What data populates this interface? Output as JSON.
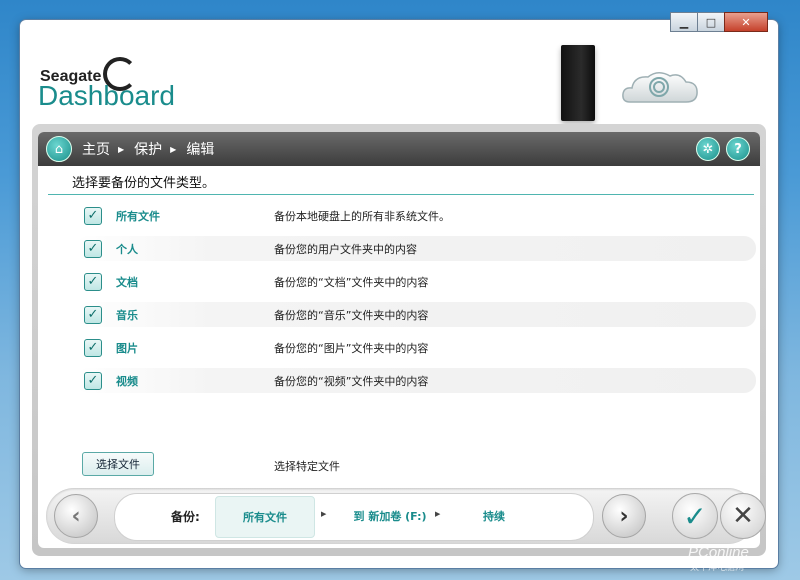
{
  "window": {
    "controls": {
      "minimize": "▁",
      "maximize": "□",
      "close": "✕"
    }
  },
  "brand": {
    "small": "Seagate",
    "big": "Dashboard"
  },
  "breadcrumb": {
    "items": [
      "主页",
      "保护",
      "编辑"
    ],
    "home_icon": "home-icon",
    "settings_icon": "gear-icon",
    "help_icon": "?"
  },
  "instruction": "选择要备份的文件类型。",
  "file_types": [
    {
      "label": "所有文件",
      "desc": "备份本地硬盘上的所有非系统文件。",
      "checked": true
    },
    {
      "label": "个人",
      "desc": "备份您的用户文件夹中的内容",
      "checked": true
    },
    {
      "label": "文档",
      "desc": "备份您的“文档”文件夹中的内容",
      "checked": true
    },
    {
      "label": "音乐",
      "desc": "备份您的“音乐”文件夹中的内容",
      "checked": true
    },
    {
      "label": "图片",
      "desc": "备份您的“图片”文件夹中的内容",
      "checked": true
    },
    {
      "label": "视频",
      "desc": "备份您的“视频”文件夹中的内容",
      "checked": true
    }
  ],
  "check_glyph": "✓",
  "select_files": {
    "button": "选择文件",
    "desc": "选择特定文件"
  },
  "footer": {
    "prev_glyph": "‹",
    "next_glyph": "›",
    "status_label": "备份:",
    "seg1": "所有文件",
    "seg2": "到 新加卷 (F:)",
    "seg3": "持续",
    "arrow": "▶",
    "confirm_glyph": "✓",
    "cancel_glyph": "✕"
  },
  "watermark": {
    "main": "PConline",
    "sub": "太平洋电脑网"
  },
  "colors": {
    "accent": "#1a8c8c",
    "bar": "#4a4a4a"
  }
}
